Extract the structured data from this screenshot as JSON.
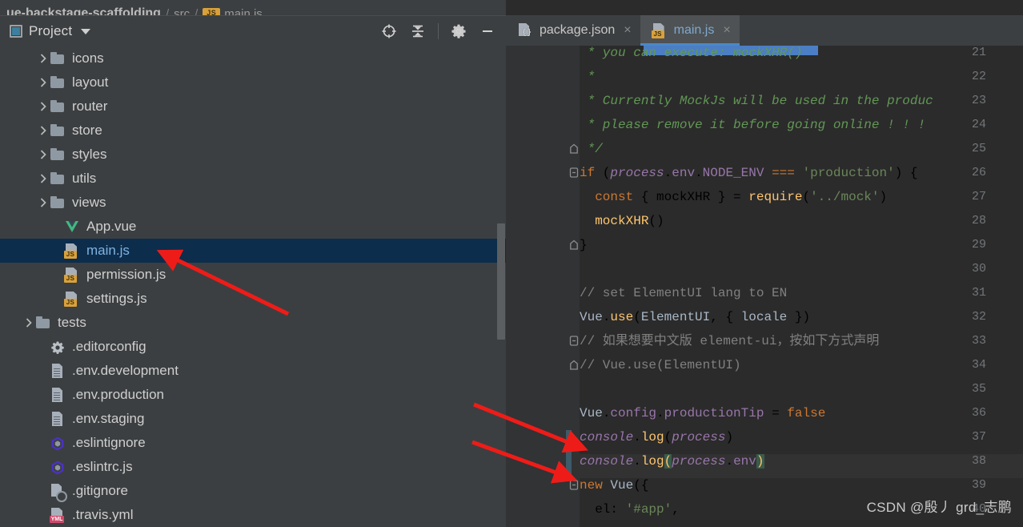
{
  "breadcrumb": {
    "project": "ue-backstage-scaffolding",
    "sep1": "/",
    "folder": "src",
    "sep2": "/",
    "file_badge": "JS",
    "file": "main.js"
  },
  "panel": {
    "title": "Project",
    "icon": "project-window-icon",
    "caret": "chevron-down-icon",
    "tools": [
      {
        "name": "locate-icon",
        "title": "Select Opened File"
      },
      {
        "name": "collapse-all-icon",
        "title": "Collapse All"
      },
      {
        "name": "gear-icon",
        "title": "Settings"
      },
      {
        "name": "minimize-icon",
        "title": "Hide"
      }
    ]
  },
  "tree": {
    "items": [
      {
        "label": "icons",
        "icon": "folder-icon",
        "arrow": true,
        "indent": 2,
        "selected": false
      },
      {
        "label": "layout",
        "icon": "folder-icon",
        "arrow": true,
        "indent": 2,
        "selected": false
      },
      {
        "label": "router",
        "icon": "folder-icon",
        "arrow": true,
        "indent": 2,
        "selected": false
      },
      {
        "label": "store",
        "icon": "folder-icon",
        "arrow": true,
        "indent": 2,
        "selected": false
      },
      {
        "label": "styles",
        "icon": "folder-icon",
        "arrow": true,
        "indent": 2,
        "selected": false
      },
      {
        "label": "utils",
        "icon": "folder-icon",
        "arrow": true,
        "indent": 2,
        "selected": false
      },
      {
        "label": "views",
        "icon": "folder-icon",
        "arrow": true,
        "indent": 2,
        "selected": false
      },
      {
        "label": "App.vue",
        "icon": "vue-file-icon",
        "arrow": false,
        "indent": 3,
        "selected": false
      },
      {
        "label": "main.js",
        "icon": "js-file-icon",
        "arrow": false,
        "indent": 3,
        "selected": true
      },
      {
        "label": "permission.js",
        "icon": "js-file-icon",
        "arrow": false,
        "indent": 3,
        "selected": false
      },
      {
        "label": "settings.js",
        "icon": "js-file-icon",
        "arrow": false,
        "indent": 3,
        "selected": false
      },
      {
        "label": "tests",
        "icon": "folder-icon",
        "arrow": true,
        "indent": 1,
        "selected": false
      },
      {
        "label": ".editorconfig",
        "icon": "gear-file-icon",
        "arrow": false,
        "indent": 2,
        "selected": false
      },
      {
        "label": ".env.development",
        "icon": "text-file-icon",
        "arrow": false,
        "indent": 2,
        "selected": false
      },
      {
        "label": ".env.production",
        "icon": "text-file-icon",
        "arrow": false,
        "indent": 2,
        "selected": false
      },
      {
        "label": ".env.staging",
        "icon": "text-file-icon",
        "arrow": false,
        "indent": 2,
        "selected": false
      },
      {
        "label": ".eslintignore",
        "icon": "eslint-file-icon",
        "arrow": false,
        "indent": 2,
        "selected": false
      },
      {
        "label": ".eslintrc.js",
        "icon": "eslint-file-icon",
        "arrow": false,
        "indent": 2,
        "selected": false
      },
      {
        "label": ".gitignore",
        "icon": "gitignore-file-icon",
        "arrow": false,
        "indent": 2,
        "selected": false
      },
      {
        "label": ".travis.yml",
        "icon": "yml-file-icon",
        "arrow": false,
        "indent": 2,
        "selected": false
      }
    ]
  },
  "tabs": [
    {
      "label": "package.json",
      "icon": "json-file-icon",
      "active": false,
      "close": "×"
    },
    {
      "label": "main.js",
      "icon": "js-file-icon",
      "active": true,
      "close": "×"
    }
  ],
  "editor": {
    "first_line": 21,
    "last_line": 40,
    "current_line": 38,
    "lines": [
      {
        "n": 21,
        "text": " * you can execute: mockXHR()"
      },
      {
        "n": 22,
        "text": " *"
      },
      {
        "n": 23,
        "text": " * Currently MockJs will be used in the produc"
      },
      {
        "n": 24,
        "text": " * please remove it before going online ! ! !"
      },
      {
        "n": 25,
        "text": " */"
      },
      {
        "n": 26,
        "text": "if (process.env.NODE_ENV === 'production') {"
      },
      {
        "n": 27,
        "text": "  const { mockXHR } = require('../mock')"
      },
      {
        "n": 28,
        "text": "  mockXHR()"
      },
      {
        "n": 29,
        "text": "}"
      },
      {
        "n": 30,
        "text": ""
      },
      {
        "n": 31,
        "text": "// set ElementUI lang to EN"
      },
      {
        "n": 32,
        "text": "Vue.use(ElementUI, { locale })"
      },
      {
        "n": 33,
        "text": "// 如果想要中文版 element-ui，按如下方式声明"
      },
      {
        "n": 34,
        "text": "// Vue.use(ElementUI)"
      },
      {
        "n": 35,
        "text": ""
      },
      {
        "n": 36,
        "text": "Vue.config.productionTip = false"
      },
      {
        "n": 37,
        "text": "console.log(process)"
      },
      {
        "n": 38,
        "text": "console.log(process.env)"
      },
      {
        "n": 39,
        "text": "new Vue({"
      },
      {
        "n": 40,
        "text": "  el: '#app',"
      }
    ]
  },
  "annotations": {
    "arrow_count": 3,
    "arrow_color": "#ee1c18"
  },
  "watermark": "CSDN @殷丿 grd_志鹏",
  "colors": {
    "panel_bg": "#3c3f41",
    "editor_bg": "#2b2b2b",
    "gutter_bg": "#313335",
    "selection_bg": "#0d2d4c",
    "tab_active_bg": "#4e5254",
    "tab_underline": "#4a88c7",
    "accent_js": "#d9a13b",
    "comment_green": "#629755",
    "keyword_orange": "#cc7832",
    "string_green": "#6a8759",
    "field_purple": "#9876aa",
    "function_yellow": "#ffc66d"
  }
}
